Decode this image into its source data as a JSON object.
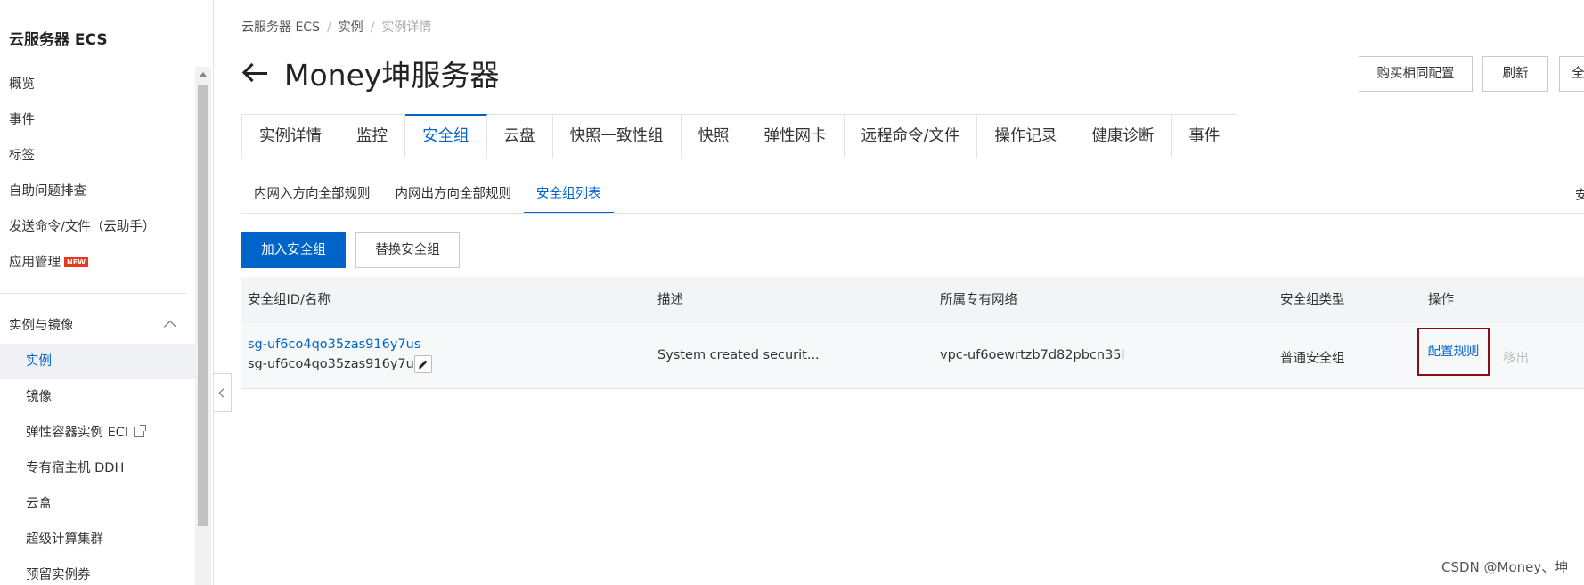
{
  "sidebar": {
    "title": "云服务器 ECS",
    "items": [
      {
        "label": "概览"
      },
      {
        "label": "事件"
      },
      {
        "label": "标签"
      },
      {
        "label": "自助问题排查"
      },
      {
        "label": "发送命令/文件（云助手）"
      },
      {
        "label": "应用管理",
        "badge": "NEW"
      }
    ],
    "group": {
      "label": "实例与镜像"
    },
    "sub_items": [
      {
        "label": "实例"
      },
      {
        "label": "镜像"
      },
      {
        "label": "弹性容器实例 ECI"
      },
      {
        "label": "专有宿主机 DDH"
      },
      {
        "label": "云盒"
      },
      {
        "label": "超级计算集群"
      },
      {
        "label": "预留实例券"
      }
    ]
  },
  "breadcrumb": {
    "items": [
      "云服务器 ECS",
      "实例",
      "实例详情"
    ]
  },
  "page": {
    "title": "Money坤服务器"
  },
  "header_buttons": {
    "buy_same": "购买相同配置",
    "refresh": "刷新",
    "more": "全"
  },
  "tabs": [
    "实例详情",
    "监控",
    "安全组",
    "云盘",
    "快照一致性组",
    "快照",
    "弹性网卡",
    "远程命令/文件",
    "操作记录",
    "健康诊断",
    "事件"
  ],
  "subtabs": [
    "内网入方向全部规则",
    "内网出方向全部规则",
    "安全组列表"
  ],
  "subtab_extra": "安",
  "actions": {
    "join": "加入安全组",
    "replace": "替换安全组"
  },
  "table": {
    "columns": [
      "安全组ID/名称",
      "描述",
      "所属专有网络",
      "安全组类型",
      "操作"
    ],
    "rows": [
      {
        "id": "sg-uf6co4qo35zas916y7us",
        "name": "sg-uf6co4qo35zas916y7u...",
        "description": "System created securit...",
        "vpc": "vpc-uf6oewrtzb7d82pbcn35l",
        "type": "普通安全组",
        "action_config": "配置规则",
        "action_remove": "移出"
      }
    ]
  },
  "watermark": "CSDN @Money、坤",
  "colors": {
    "accent": "#0064c8",
    "highlight_border": "#8b0c12",
    "badge": "#e8371d"
  }
}
